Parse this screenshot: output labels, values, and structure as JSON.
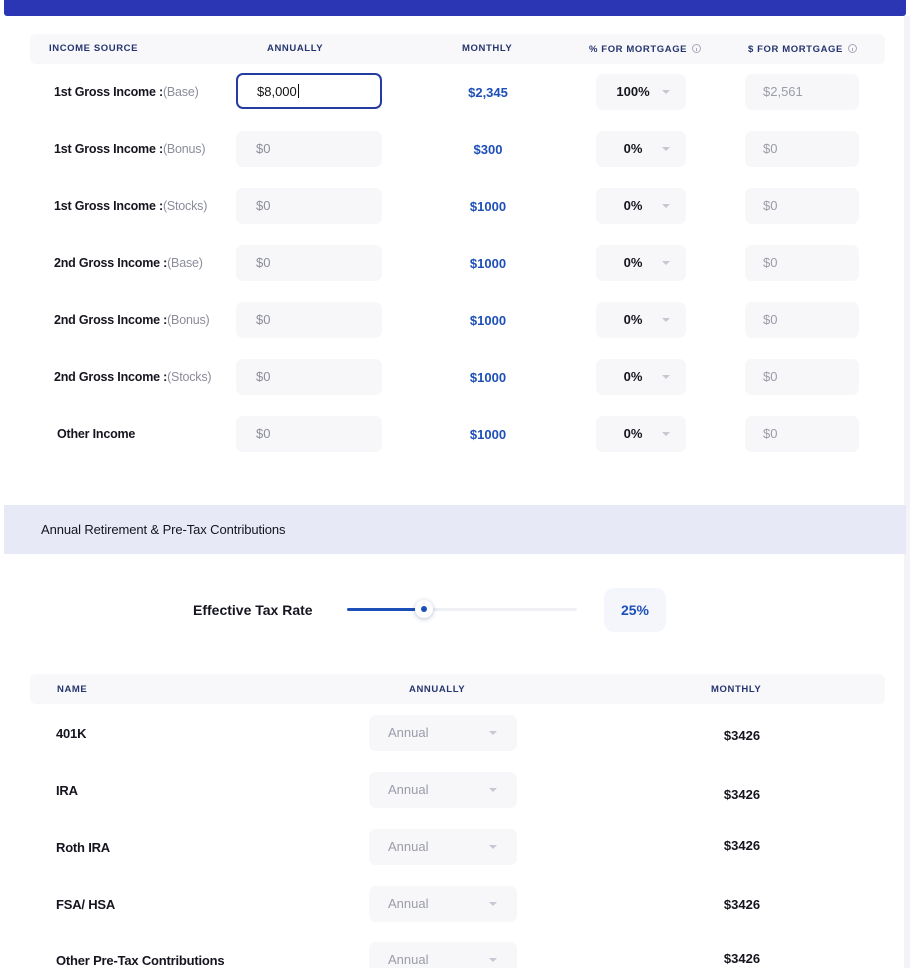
{
  "income_table": {
    "headers": {
      "source": "INCOME SOURCE",
      "annually": "ANNUALLY",
      "monthly": "MONTHLY",
      "pct_mortgage": "% FOR MORTGAGE",
      "dol_mortgage": "$ FOR MORTGAGE"
    },
    "rows": [
      {
        "label": "1st Gross Income :",
        "sub": "(Base)",
        "annual": "$8,000",
        "monthly": "$2,345",
        "pct": "100%",
        "dol": "$2,561"
      },
      {
        "label": "1st Gross Income :",
        "sub": "(Bonus)",
        "annual": "$0",
        "monthly": "$300",
        "pct": "0%",
        "dol": "$0"
      },
      {
        "label": "1st Gross Income :",
        "sub": "(Stocks)",
        "annual": "$0",
        "monthly": "$1000",
        "pct": "0%",
        "dol": "$0"
      },
      {
        "label": "2nd Gross Income :",
        "sub": "(Base)",
        "annual": "$0",
        "monthly": "$1000",
        "pct": "0%",
        "dol": "$0"
      },
      {
        "label": "2nd Gross Income :",
        "sub": "(Bonus)",
        "annual": "$0",
        "monthly": "$1000",
        "pct": "0%",
        "dol": "$0"
      },
      {
        "label": "2nd Gross Income :",
        "sub": "(Stocks)",
        "annual": "$0",
        "monthly": "$1000",
        "pct": "0%",
        "dol": "$0"
      },
      {
        "label": "Other Income",
        "sub": "",
        "annual": "$0",
        "monthly": "$1000",
        "pct": "0%",
        "dol": "$0"
      }
    ]
  },
  "retirement": {
    "section_title": "Annual Retirement & Pre-Tax Contributions",
    "tax_rate_label": "Effective Tax Rate",
    "tax_rate_value": "25%",
    "tax_rate_fraction": 0.33,
    "headers": {
      "name": "NAME",
      "annually": "ANNUALLY",
      "monthly": "MONTHLY"
    },
    "rows": [
      {
        "name": "401K",
        "frequency": "Annual",
        "monthly": "$3426"
      },
      {
        "name": "IRA",
        "frequency": "Annual",
        "monthly": "$3426"
      },
      {
        "name": "Roth IRA",
        "frequency": "Annual",
        "monthly": "$3426"
      },
      {
        "name": "FSA/ HSA",
        "frequency": "Annual",
        "monthly": "$3426"
      },
      {
        "name": "Other Pre-Tax  Contributions",
        "frequency": "Annual",
        "monthly": "$3426"
      }
    ]
  },
  "colors": {
    "accent": "#1d4fb8",
    "topbar": "#2b36b4",
    "band": "#e8e9f7"
  }
}
